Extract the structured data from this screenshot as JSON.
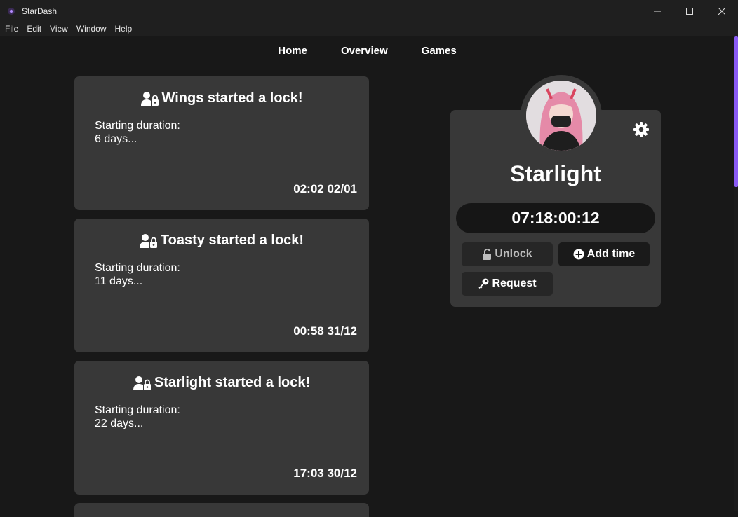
{
  "window": {
    "title": "StarDash"
  },
  "menu": [
    "File",
    "Edit",
    "View",
    "Window",
    "Help"
  ],
  "nav": [
    "Home",
    "Overview",
    "Games"
  ],
  "feed": [
    {
      "title": "Wings started a lock!",
      "label": "Starting duration:",
      "duration": "6 days...",
      "time": "02:02 02/01"
    },
    {
      "title": "Toasty started a lock!",
      "label": "Starting duration:",
      "duration": "11 days...",
      "time": "00:58 31/12"
    },
    {
      "title": "Starlight started a lock!",
      "label": "Starting duration:",
      "duration": "22 days...",
      "time": "17:03 30/12"
    }
  ],
  "profile": {
    "name": "Starlight",
    "timer": "07:18:00:12",
    "buttons": {
      "unlock": "Unlock",
      "add_time": "Add time",
      "request": "Request"
    }
  },
  "colors": {
    "accent": "#8b5cf6",
    "card": "#383838",
    "background": "#181818"
  }
}
